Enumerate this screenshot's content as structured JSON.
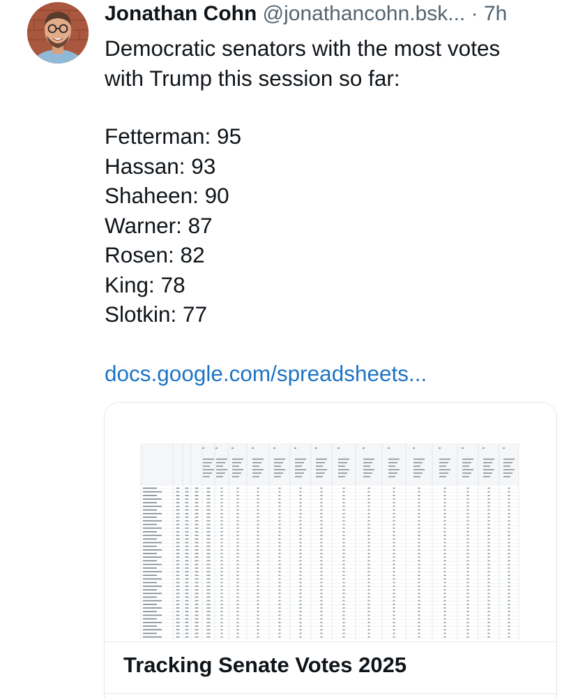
{
  "post": {
    "author_name": "Jonathan Cohn",
    "handle": "@jonathancohn.bsk...",
    "separator": "·",
    "time": "7h",
    "text_lines": [
      "Democratic senators with the most votes",
      "with Trump this session so far:"
    ],
    "vote_list": [
      "Fetterman: 95",
      "Hassan: 93",
      "Shaheen: 90",
      "Warner: 87",
      "Rosen: 82",
      "King: 78",
      "Slotkin: 77"
    ],
    "link_text": "docs.google.com/spreadsheets..."
  },
  "card": {
    "title": "Tracking Senate Votes 2025",
    "thumbnail": "spreadsheet-preview"
  },
  "colors": {
    "link": "#1d74c4",
    "muted": "#536471",
    "text": "#0f1419"
  }
}
